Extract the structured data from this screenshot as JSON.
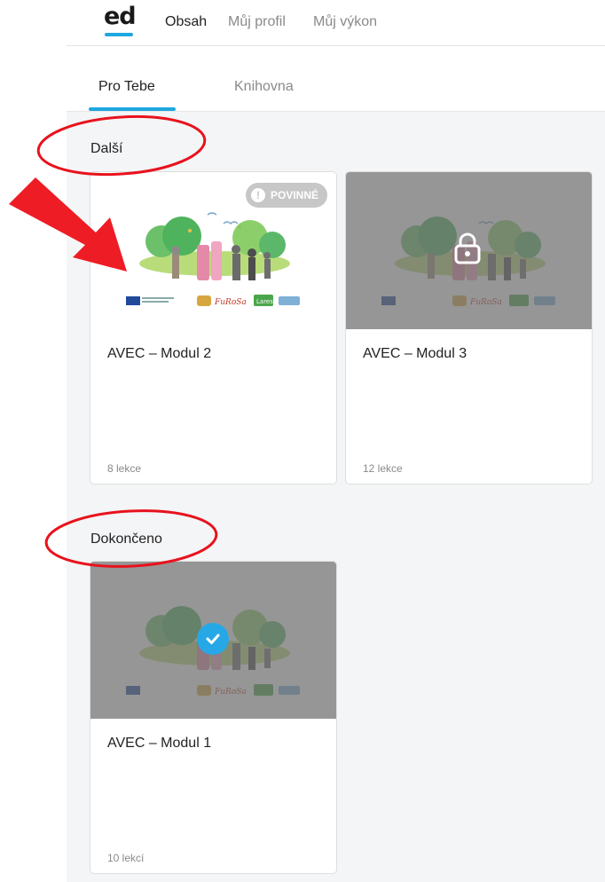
{
  "logo": {
    "text": "ed"
  },
  "nav": {
    "items": [
      {
        "label": "Obsah"
      },
      {
        "label": "Můj profil"
      },
      {
        "label": "Můj výkon"
      }
    ]
  },
  "subtabs": [
    {
      "label": "Pro Tebe"
    },
    {
      "label": "Knihovna"
    }
  ],
  "sections": {
    "next": {
      "title": "Další"
    },
    "completed": {
      "title": "Dokončeno"
    }
  },
  "cards": [
    {
      "title": "AVEC – Modul 2",
      "count": "8 lekce",
      "badge": "POVINNÉ",
      "state": "required"
    },
    {
      "title": "AVEC – Modul 3",
      "count": "12 lekce",
      "state": "locked"
    },
    {
      "title": "AVEC – Modul 1",
      "count": "10 lekcí",
      "state": "completed"
    }
  ],
  "colors": {
    "accent": "#1ea7e0",
    "annotation": "#e8121c",
    "check": "#27a8e6"
  }
}
